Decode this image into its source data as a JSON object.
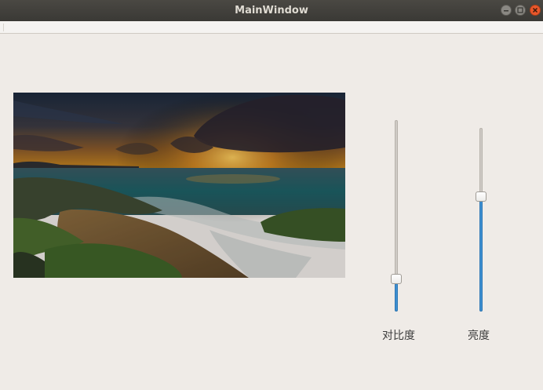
{
  "window": {
    "title": "MainWindow"
  },
  "image": {
    "description_icon": "image-icon"
  },
  "sliders": [
    {
      "name": "contrast",
      "label": "对比度",
      "value_fraction": 0.14
    },
    {
      "name": "brightness",
      "label": "亮度",
      "value_fraction": 0.62
    }
  ],
  "colors": {
    "accent": "#3d8fd1",
    "close": "#e9572b",
    "titlebar": "#3f3d39"
  }
}
